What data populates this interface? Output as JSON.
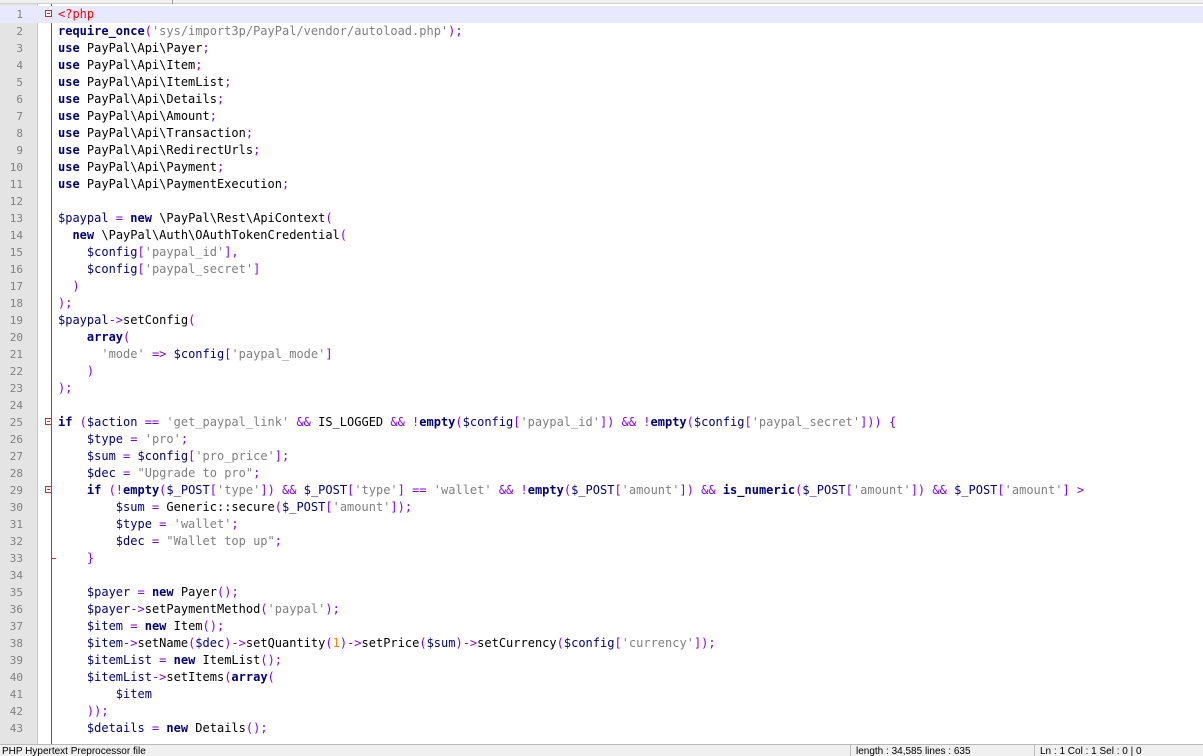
{
  "status_bar": {
    "file_type": "PHP Hypertext Preprocessor file",
    "length": "length : 34,585    lines : 635",
    "position": "Ln : 1    Col : 1    Sel : 0 | 0"
  },
  "editor": {
    "fold_markers": {
      "start": [
        1,
        25,
        29
      ],
      "end": [
        33
      ]
    },
    "current_line": 1,
    "lines": [
      {
        "n": "1",
        "tokens": [
          [
            "phptag",
            "<?php"
          ]
        ]
      },
      {
        "n": "2",
        "tokens": [
          [
            "kw",
            "require_once"
          ],
          [
            "op",
            "("
          ],
          [
            "str",
            "'sys/import3p/PayPal/vendor/autoload.php'"
          ],
          [
            "op",
            ");"
          ]
        ]
      },
      {
        "n": "3",
        "tokens": [
          [
            "kw",
            "use"
          ],
          [
            "ident",
            " PayPal\\Api\\Payer"
          ],
          [
            "op",
            ";"
          ]
        ]
      },
      {
        "n": "4",
        "tokens": [
          [
            "kw",
            "use"
          ],
          [
            "ident",
            " PayPal\\Api\\Item"
          ],
          [
            "op",
            ";"
          ]
        ]
      },
      {
        "n": "5",
        "tokens": [
          [
            "kw",
            "use"
          ],
          [
            "ident",
            " PayPal\\Api\\ItemList"
          ],
          [
            "op",
            ";"
          ]
        ]
      },
      {
        "n": "6",
        "tokens": [
          [
            "kw",
            "use"
          ],
          [
            "ident",
            " PayPal\\Api\\Details"
          ],
          [
            "op",
            ";"
          ]
        ]
      },
      {
        "n": "7",
        "tokens": [
          [
            "kw",
            "use"
          ],
          [
            "ident",
            " PayPal\\Api\\Amount"
          ],
          [
            "op",
            ";"
          ]
        ]
      },
      {
        "n": "8",
        "tokens": [
          [
            "kw",
            "use"
          ],
          [
            "ident",
            " PayPal\\Api\\Transaction"
          ],
          [
            "op",
            ";"
          ]
        ]
      },
      {
        "n": "9",
        "tokens": [
          [
            "kw",
            "use"
          ],
          [
            "ident",
            " PayPal\\Api\\RedirectUrls"
          ],
          [
            "op",
            ";"
          ]
        ]
      },
      {
        "n": "10",
        "tokens": [
          [
            "kw",
            "use"
          ],
          [
            "ident",
            " PayPal\\Api\\Payment"
          ],
          [
            "op",
            ";"
          ]
        ]
      },
      {
        "n": "11",
        "tokens": [
          [
            "kw",
            "use"
          ],
          [
            "ident",
            " PayPal\\Api\\PaymentExecution"
          ],
          [
            "op",
            ";"
          ]
        ]
      },
      {
        "n": "12",
        "tokens": []
      },
      {
        "n": "13",
        "tokens": [
          [
            "var",
            "$paypal"
          ],
          [
            "op",
            " = "
          ],
          [
            "kw",
            "new"
          ],
          [
            "ident",
            " \\PayPal\\Rest\\ApiContext"
          ],
          [
            "op",
            "("
          ]
        ]
      },
      {
        "n": "14",
        "tokens": [
          [
            "ident",
            "  "
          ],
          [
            "kw",
            "new"
          ],
          [
            "ident",
            " \\PayPal\\Auth\\OAuthTokenCredential"
          ],
          [
            "op",
            "("
          ]
        ]
      },
      {
        "n": "15",
        "tokens": [
          [
            "ident",
            "    "
          ],
          [
            "var",
            "$config"
          ],
          [
            "op",
            "["
          ],
          [
            "str",
            "'paypal_id'"
          ],
          [
            "op",
            "],"
          ]
        ]
      },
      {
        "n": "16",
        "tokens": [
          [
            "ident",
            "    "
          ],
          [
            "var",
            "$config"
          ],
          [
            "op",
            "["
          ],
          [
            "str",
            "'paypal_secret'"
          ],
          [
            "op",
            "]"
          ]
        ]
      },
      {
        "n": "17",
        "tokens": [
          [
            "ident",
            "  "
          ],
          [
            "op",
            ")"
          ]
        ]
      },
      {
        "n": "18",
        "tokens": [
          [
            "op",
            ");"
          ]
        ]
      },
      {
        "n": "19",
        "tokens": [
          [
            "var",
            "$paypal"
          ],
          [
            "op",
            "->"
          ],
          [
            "ident",
            "setConfig"
          ],
          [
            "op",
            "("
          ]
        ]
      },
      {
        "n": "20",
        "tokens": [
          [
            "ident",
            "    "
          ],
          [
            "kw",
            "array"
          ],
          [
            "op",
            "("
          ]
        ]
      },
      {
        "n": "21",
        "tokens": [
          [
            "ident",
            "      "
          ],
          [
            "str",
            "'mode'"
          ],
          [
            "op",
            " => "
          ],
          [
            "var",
            "$config"
          ],
          [
            "op",
            "["
          ],
          [
            "str",
            "'paypal_mode'"
          ],
          [
            "op",
            "]"
          ]
        ]
      },
      {
        "n": "22",
        "tokens": [
          [
            "ident",
            "    "
          ],
          [
            "op",
            ")"
          ]
        ]
      },
      {
        "n": "23",
        "tokens": [
          [
            "op",
            ");"
          ]
        ]
      },
      {
        "n": "24",
        "tokens": []
      },
      {
        "n": "25",
        "tokens": [
          [
            "kw",
            "if"
          ],
          [
            "op",
            " ("
          ],
          [
            "var",
            "$action"
          ],
          [
            "op",
            " == "
          ],
          [
            "str",
            "'get_paypal_link'"
          ],
          [
            "op",
            " && "
          ],
          [
            "ident",
            "IS_LOGGED"
          ],
          [
            "op",
            " && !"
          ],
          [
            "kw",
            "empty"
          ],
          [
            "op",
            "("
          ],
          [
            "var",
            "$config"
          ],
          [
            "op",
            "["
          ],
          [
            "str",
            "'paypal_id'"
          ],
          [
            "op",
            "]) && !"
          ],
          [
            "kw",
            "empty"
          ],
          [
            "op",
            "("
          ],
          [
            "var",
            "$config"
          ],
          [
            "op",
            "["
          ],
          [
            "str",
            "'paypal_secret'"
          ],
          [
            "op",
            "])) {"
          ]
        ]
      },
      {
        "n": "26",
        "tokens": [
          [
            "ident",
            "    "
          ],
          [
            "var",
            "$type"
          ],
          [
            "op",
            " = "
          ],
          [
            "str",
            "'pro'"
          ],
          [
            "op",
            ";"
          ]
        ]
      },
      {
        "n": "27",
        "tokens": [
          [
            "ident",
            "    "
          ],
          [
            "var",
            "$sum"
          ],
          [
            "op",
            " = "
          ],
          [
            "var",
            "$config"
          ],
          [
            "op",
            "["
          ],
          [
            "str",
            "'pro_price'"
          ],
          [
            "op",
            "];"
          ]
        ]
      },
      {
        "n": "28",
        "tokens": [
          [
            "ident",
            "    "
          ],
          [
            "var",
            "$dec"
          ],
          [
            "op",
            " = "
          ],
          [
            "str",
            "\"Upgrade to pro\""
          ],
          [
            "op",
            ";"
          ]
        ]
      },
      {
        "n": "29",
        "tokens": [
          [
            "ident",
            "    "
          ],
          [
            "kw",
            "if"
          ],
          [
            "op",
            " (!"
          ],
          [
            "kw",
            "empty"
          ],
          [
            "op",
            "("
          ],
          [
            "var",
            "$_POST"
          ],
          [
            "op",
            "["
          ],
          [
            "str",
            "'type'"
          ],
          [
            "op",
            "]) && "
          ],
          [
            "var",
            "$_POST"
          ],
          [
            "op",
            "["
          ],
          [
            "str",
            "'type'"
          ],
          [
            "op",
            "] == "
          ],
          [
            "str",
            "'wallet'"
          ],
          [
            "op",
            " && !"
          ],
          [
            "kw",
            "empty"
          ],
          [
            "op",
            "("
          ],
          [
            "var",
            "$_POST"
          ],
          [
            "op",
            "["
          ],
          [
            "str",
            "'amount'"
          ],
          [
            "op",
            "]) && "
          ],
          [
            "kw",
            "is_numeric"
          ],
          [
            "op",
            "("
          ],
          [
            "var",
            "$_POST"
          ],
          [
            "op",
            "["
          ],
          [
            "str",
            "'amount'"
          ],
          [
            "op",
            "]) && "
          ],
          [
            "var",
            "$_POST"
          ],
          [
            "op",
            "["
          ],
          [
            "str",
            "'amount'"
          ],
          [
            "op",
            "] >"
          ]
        ]
      },
      {
        "n": "30",
        "tokens": [
          [
            "ident",
            "        "
          ],
          [
            "var",
            "$sum"
          ],
          [
            "op",
            " = "
          ],
          [
            "ident",
            "Generic::secure"
          ],
          [
            "op",
            "("
          ],
          [
            "var",
            "$_POST"
          ],
          [
            "op",
            "["
          ],
          [
            "str",
            "'amount'"
          ],
          [
            "op",
            "]);"
          ]
        ]
      },
      {
        "n": "31",
        "tokens": [
          [
            "ident",
            "        "
          ],
          [
            "var",
            "$type"
          ],
          [
            "op",
            " = "
          ],
          [
            "str",
            "'wallet'"
          ],
          [
            "op",
            ";"
          ]
        ]
      },
      {
        "n": "32",
        "tokens": [
          [
            "ident",
            "        "
          ],
          [
            "var",
            "$dec"
          ],
          [
            "op",
            " = "
          ],
          [
            "str",
            "\"Wallet top up\""
          ],
          [
            "op",
            ";"
          ]
        ]
      },
      {
        "n": "33",
        "tokens": [
          [
            "ident",
            "    "
          ],
          [
            "op",
            "}"
          ]
        ]
      },
      {
        "n": "34",
        "tokens": []
      },
      {
        "n": "35",
        "tokens": [
          [
            "ident",
            "    "
          ],
          [
            "var",
            "$payer"
          ],
          [
            "op",
            " = "
          ],
          [
            "kw",
            "new"
          ],
          [
            "ident",
            " Payer"
          ],
          [
            "op",
            "();"
          ]
        ]
      },
      {
        "n": "36",
        "tokens": [
          [
            "ident",
            "    "
          ],
          [
            "var",
            "$payer"
          ],
          [
            "op",
            "->"
          ],
          [
            "ident",
            "setPaymentMethod"
          ],
          [
            "op",
            "("
          ],
          [
            "str",
            "'paypal'"
          ],
          [
            "op",
            ");"
          ]
        ]
      },
      {
        "n": "37",
        "tokens": [
          [
            "ident",
            "    "
          ],
          [
            "var",
            "$item"
          ],
          [
            "op",
            " = "
          ],
          [
            "kw",
            "new"
          ],
          [
            "ident",
            " Item"
          ],
          [
            "op",
            "();"
          ]
        ]
      },
      {
        "n": "38",
        "tokens": [
          [
            "ident",
            "    "
          ],
          [
            "var",
            "$item"
          ],
          [
            "op",
            "->"
          ],
          [
            "ident",
            "setName"
          ],
          [
            "op",
            "("
          ],
          [
            "var",
            "$dec"
          ],
          [
            "op",
            ")->"
          ],
          [
            "ident",
            "setQuantity"
          ],
          [
            "op",
            "("
          ],
          [
            "num",
            "1"
          ],
          [
            "op",
            ")->"
          ],
          [
            "ident",
            "setPrice"
          ],
          [
            "op",
            "("
          ],
          [
            "var",
            "$sum"
          ],
          [
            "op",
            ")->"
          ],
          [
            "ident",
            "setCurrency"
          ],
          [
            "op",
            "("
          ],
          [
            "var",
            "$config"
          ],
          [
            "op",
            "["
          ],
          [
            "str",
            "'currency'"
          ],
          [
            "op",
            "]);"
          ]
        ]
      },
      {
        "n": "39",
        "tokens": [
          [
            "ident",
            "    "
          ],
          [
            "var",
            "$itemList"
          ],
          [
            "op",
            " = "
          ],
          [
            "kw",
            "new"
          ],
          [
            "ident",
            " ItemList"
          ],
          [
            "op",
            "();"
          ]
        ]
      },
      {
        "n": "40",
        "tokens": [
          [
            "ident",
            "    "
          ],
          [
            "var",
            "$itemList"
          ],
          [
            "op",
            "->"
          ],
          [
            "ident",
            "setItems"
          ],
          [
            "op",
            "("
          ],
          [
            "kw",
            "array"
          ],
          [
            "op",
            "("
          ]
        ]
      },
      {
        "n": "41",
        "tokens": [
          [
            "ident",
            "        "
          ],
          [
            "var",
            "$item"
          ]
        ]
      },
      {
        "n": "42",
        "tokens": [
          [
            "ident",
            "    "
          ],
          [
            "op",
            "));"
          ]
        ]
      },
      {
        "n": "43",
        "tokens": [
          [
            "ident",
            "    "
          ],
          [
            "var",
            "$details"
          ],
          [
            "op",
            " = "
          ],
          [
            "kw",
            "new"
          ],
          [
            "ident",
            " Details"
          ],
          [
            "op",
            "();"
          ]
        ]
      }
    ]
  }
}
